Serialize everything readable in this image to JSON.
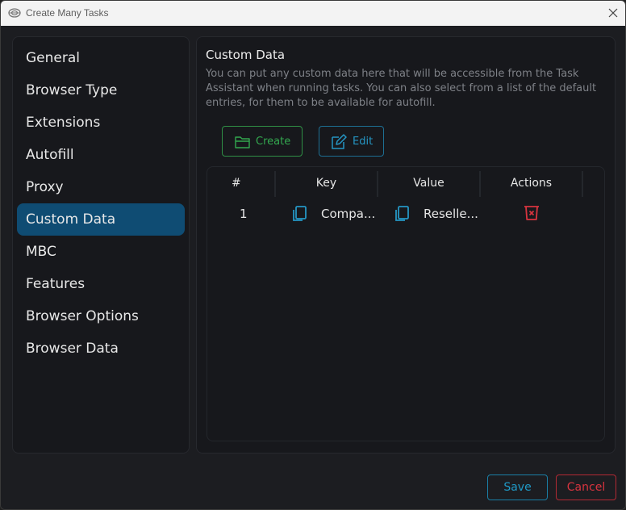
{
  "window": {
    "title": "Create Many Tasks"
  },
  "sidebar": {
    "items": [
      {
        "label": "General"
      },
      {
        "label": "Browser Type"
      },
      {
        "label": "Extensions"
      },
      {
        "label": "Autofill"
      },
      {
        "label": "Proxy"
      },
      {
        "label": "Custom Data",
        "active": true
      },
      {
        "label": "MBC"
      },
      {
        "label": "Features"
      },
      {
        "label": "Browser Options"
      },
      {
        "label": "Browser Data"
      }
    ]
  },
  "panel": {
    "title": "Custom Data",
    "description": "You can put any custom data here that will be accessible from the Task Assistant when running tasks. You can also select from a list of the default entries, for them to be available for autofill.",
    "create_label": "Create",
    "edit_label": "Edit"
  },
  "table": {
    "columns": [
      "#",
      "Key",
      "Value",
      "Actions"
    ],
    "rows": [
      {
        "index": "1",
        "key": "Compa...",
        "value": "Reselle..."
      }
    ]
  },
  "footer": {
    "save_label": "Save",
    "cancel_label": "Cancel"
  },
  "colors": {
    "accent": "#0f4c73",
    "create": "#33a84f",
    "edit": "#2596c4",
    "delete": "#d8343f",
    "cancel": "#d8343f"
  },
  "icons": {
    "app": "app-icon",
    "close": "close-icon",
    "create": "folder-icon",
    "edit": "edit-icon",
    "copy": "copy-icon",
    "delete": "trash-icon"
  }
}
